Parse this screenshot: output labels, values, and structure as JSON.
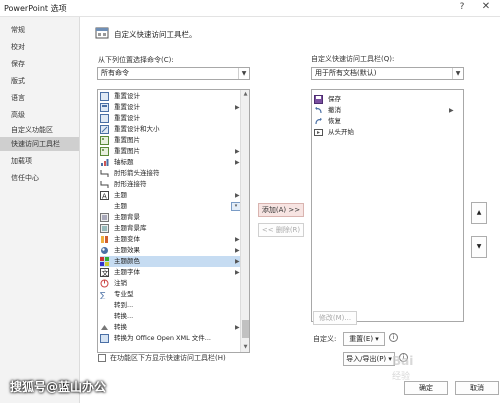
{
  "window": {
    "title": "PowerPoint 选项",
    "help_glyph": "?",
    "close_glyph": "✕"
  },
  "sidebar": {
    "items": [
      {
        "label": "常规",
        "active": false
      },
      {
        "label": "校对",
        "active": false
      },
      {
        "label": "保存",
        "active": false
      },
      {
        "label": "版式",
        "active": false
      },
      {
        "label": "语言",
        "active": false
      },
      {
        "label": "高级",
        "active": false
      },
      {
        "label": "自定义功能区",
        "active": false
      },
      {
        "label": "快速访问工具栏",
        "active": true
      },
      {
        "label": "加载项",
        "active": false
      },
      {
        "label": "信任中心",
        "active": false
      }
    ]
  },
  "header": {
    "title": "自定义快速访问工具栏。"
  },
  "left": {
    "choose_label": "从下列位置选择命令(C):",
    "choose_value": "所有命令",
    "commands": [
      {
        "label": "重置设计",
        "icon": "reset-design-icon",
        "has_submenu": false
      },
      {
        "label": "重置设计",
        "icon": "reset-design-icon",
        "has_submenu": true
      },
      {
        "label": "重置设计",
        "icon": "reset-design-icon",
        "has_submenu": false
      },
      {
        "label": "重置设计和大小",
        "icon": "reset-size-icon",
        "has_submenu": false
      },
      {
        "label": "重置图片",
        "icon": "reset-picture-icon",
        "has_submenu": false
      },
      {
        "label": "重置图片",
        "icon": "reset-picture-icon",
        "has_submenu": true
      },
      {
        "label": "轴标题",
        "icon": "axis-title-icon",
        "has_submenu": true
      },
      {
        "label": "肘形箭头连接符",
        "icon": "elbow-arrow-icon",
        "has_submenu": false
      },
      {
        "label": "肘形连接符",
        "icon": "elbow-connector-icon",
        "has_submenu": false
      },
      {
        "label": "主题",
        "icon": "theme-icon",
        "has_submenu": true
      },
      {
        "label": "主题",
        "icon": "",
        "has_submenu": false,
        "dropdown": true
      },
      {
        "label": "主题背景",
        "icon": "background-icon",
        "has_submenu": false
      },
      {
        "label": "主题背景库",
        "icon": "background-gallery-icon",
        "has_submenu": false
      },
      {
        "label": "主题变体",
        "icon": "variant-icon",
        "has_submenu": true
      },
      {
        "label": "主题效果",
        "icon": "effect-icon",
        "has_submenu": true
      },
      {
        "label": "主题颜色",
        "icon": "color-icon",
        "has_submenu": true,
        "selected": true
      },
      {
        "label": "主题字体",
        "icon": "font-icon",
        "has_submenu": true
      },
      {
        "label": "注销",
        "icon": "signout-icon",
        "has_submenu": false
      },
      {
        "label": "专业型",
        "icon": "professional-icon",
        "has_submenu": false
      },
      {
        "label": "转到...",
        "icon": "",
        "has_submenu": false
      },
      {
        "label": "转换...",
        "icon": "",
        "has_submenu": false
      },
      {
        "label": "转换",
        "icon": "convert-icon",
        "has_submenu": true
      },
      {
        "label": "转换为 Office Open XML 文件...",
        "icon": "convert-xml-icon",
        "has_submenu": false
      }
    ],
    "show_below_label": "在功能区下方显示快速访问工具栏(H)"
  },
  "middle": {
    "add_label": "添加(A) >>",
    "remove_label": "<< 删除(R)"
  },
  "right": {
    "customize_label": "自定义快速访问工具栏(Q):",
    "scope_value": "用于所有文档(默认)",
    "items": [
      {
        "label": "保存",
        "icon": "save-icon"
      },
      {
        "label": "撤消",
        "icon": "undo-icon",
        "has_submenu": true
      },
      {
        "label": "恢复",
        "icon": "redo-icon"
      },
      {
        "label": "从头开始",
        "icon": "start-icon"
      }
    ],
    "modify_label": "修改(M)...",
    "customize_label2": "自定义:",
    "reset_label": "重置(E) ▾",
    "import_export_label": "导入/导出(P) ▾",
    "info_glyph": "i",
    "up_glyph": "▲",
    "down_glyph": "▼"
  },
  "footer": {
    "ok_label": "确定",
    "cancel_label": "取消"
  },
  "watermark": {
    "text": "搜狐号@蓝山办公",
    "logo_text": "Bai 经验"
  },
  "colors": {
    "selected_row": "#c6dcf2",
    "sidebar_active": "#cfcfcf",
    "add_button": "#f7e4e2"
  }
}
